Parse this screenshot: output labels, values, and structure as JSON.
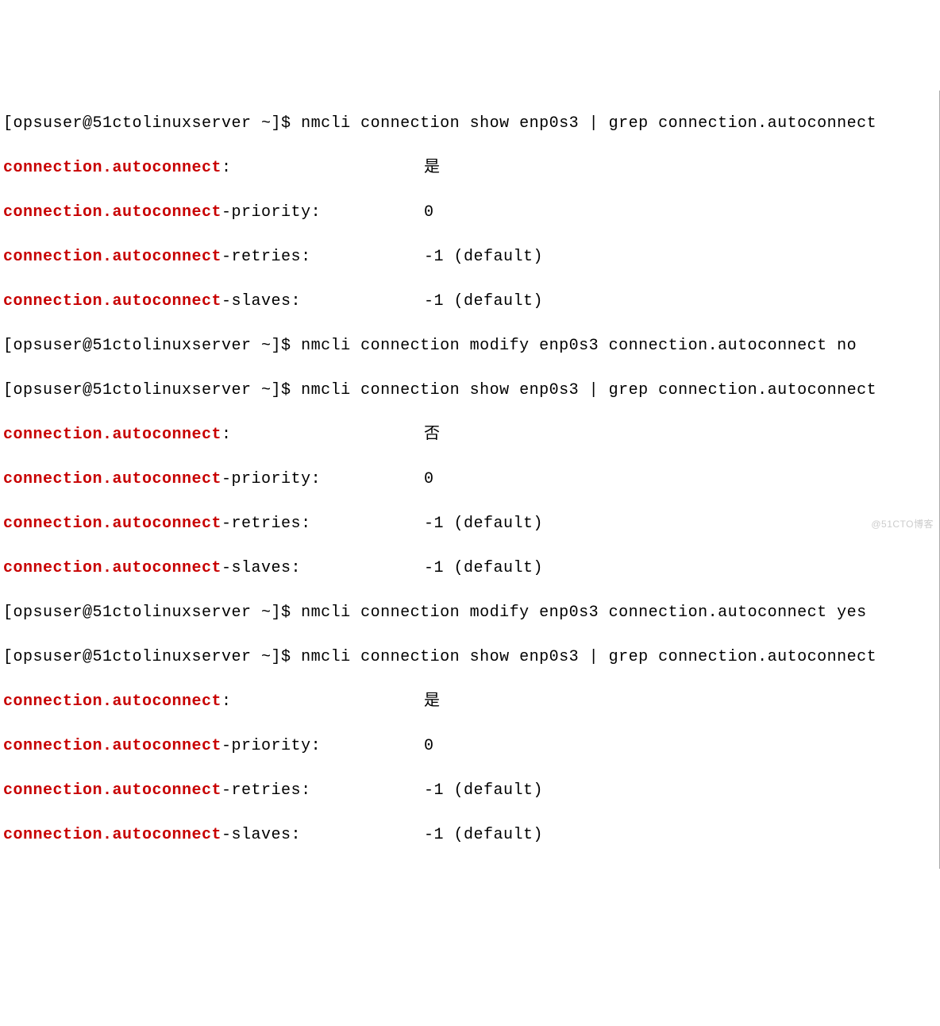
{
  "prompt": "[opsuser@51ctolinuxserver ~]$ ",
  "blocks": [
    {
      "command": "nmcli connection show enp0s3 | grep connection.autoconnect",
      "result": [
        {
          "key_hl": "connection.autoconnect",
          "key_rest": ":",
          "value": "是"
        },
        {
          "key_hl": "connection.autoconnect",
          "key_rest": "-priority:",
          "value": "0"
        },
        {
          "key_hl": "connection.autoconnect",
          "key_rest": "-retries:",
          "value": "-1 (default)"
        },
        {
          "key_hl": "connection.autoconnect",
          "key_rest": "-slaves:",
          "value": "-1 (default)"
        }
      ]
    },
    {
      "command": "nmcli connection modify enp0s3 connection.autoconnect no",
      "result": []
    },
    {
      "command": "nmcli connection show enp0s3 | grep connection.autoconnect",
      "result": [
        {
          "key_hl": "connection.autoconnect",
          "key_rest": ":",
          "value": "否"
        },
        {
          "key_hl": "connection.autoconnect",
          "key_rest": "-priority:",
          "value": "0"
        },
        {
          "key_hl": "connection.autoconnect",
          "key_rest": "-retries:",
          "value": "-1 (default)"
        },
        {
          "key_hl": "connection.autoconnect",
          "key_rest": "-slaves:",
          "value": "-1 (default)"
        }
      ]
    },
    {
      "command": "nmcli connection modify enp0s3 connection.autoconnect yes",
      "result": []
    },
    {
      "command": "nmcli connection show enp0s3 | grep connection.autoconnect",
      "result": [
        {
          "key_hl": "connection.autoconnect",
          "key_rest": ":",
          "value": "是"
        },
        {
          "key_hl": "connection.autoconnect",
          "key_rest": "-priority:",
          "value": "0"
        },
        {
          "key_hl": "connection.autoconnect",
          "key_rest": "-retries:",
          "value": "-1 (default)"
        },
        {
          "key_hl": "connection.autoconnect",
          "key_rest": "-slaves:",
          "value": "-1 (default)"
        }
      ]
    }
  ],
  "watermark": "@51CTO博客"
}
